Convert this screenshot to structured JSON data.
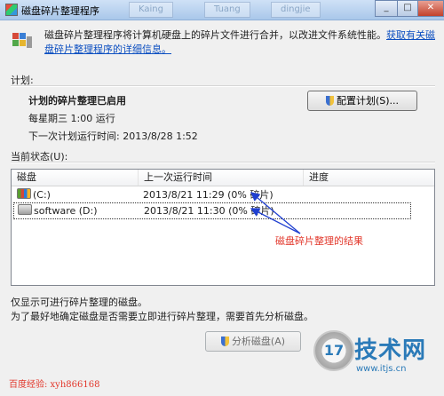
{
  "window": {
    "title": "磁盘碎片整理程序",
    "ghost_tabs": [
      "Kaing",
      "Tuang",
      "dingjie"
    ]
  },
  "intro": {
    "text": "磁盘碎片整理程序将计算机硬盘上的碎片文件进行合并，以改进文件系统性能。",
    "link": "获取有关磁盘碎片整理程序的详细信息。"
  },
  "schedule": {
    "section_label": "计划:",
    "status": "计划的碎片整理已启用",
    "frequency": "每星期三  1:00 运行",
    "next_run": "下一次计划运行时间: 2013/8/28 1:52",
    "configure_button": "配置计划(S)..."
  },
  "current_status": {
    "section_label": "当前状态(U):",
    "columns": [
      "磁盘",
      "上一次运行时间",
      "进度"
    ],
    "rows": [
      {
        "disk": "(C:)",
        "last_run": "2013/8/21 11:29 (0% 碎片)",
        "progress": ""
      },
      {
        "disk": "software (D:)",
        "last_run": "2013/8/21 11:30 (0% 碎片)",
        "progress": ""
      }
    ]
  },
  "annotation": "磁盘碎片整理的结果",
  "footer": {
    "line1": "仅显示可进行碎片整理的磁盘。",
    "line2": "为了最好地确定磁盘是否需要立即进行碎片整理，需要首先分析磁盘。",
    "analyze_button": "分析磁盘(A)"
  },
  "watermark": "百度经验: xyh866168",
  "logo": {
    "badge": "17",
    "name": "技术网",
    "url": "www.itjs.cn"
  }
}
